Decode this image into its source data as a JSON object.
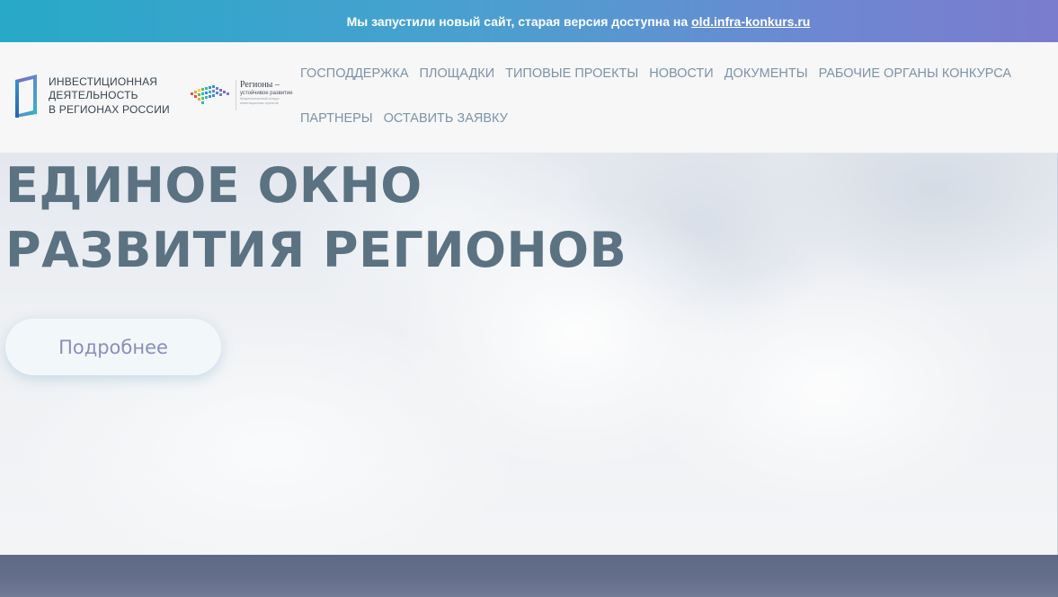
{
  "banner": {
    "message": "Мы запустили новый сайт, старая версия доступна на",
    "link_text": "old.infra-konkurs.ru"
  },
  "brand": {
    "line1": "Инвестиционная",
    "line2": "деятельность",
    "line3": "в регионах России"
  },
  "partner": {
    "title": "Регионы –",
    "subtitle": "устойчивое развитие",
    "caption": "Межрегиональный конкурс инвестиционных проектов"
  },
  "nav": {
    "items": [
      {
        "label": "Господдержка"
      },
      {
        "label": "Площадки"
      },
      {
        "label": "Типовые проекты"
      },
      {
        "label": "Новости"
      },
      {
        "label": "Документы"
      },
      {
        "label": "Рабочие органы конкурса"
      },
      {
        "label": "Партнеры"
      },
      {
        "label": "Оставить заявку"
      }
    ]
  },
  "hero": {
    "title": "Единое окно развития регионов",
    "button_label": "Подробнее"
  },
  "colors": {
    "banner_start": "#27a9c7",
    "banner_end": "#7b7cce",
    "nav_text": "#7d93a8",
    "hero_title": "#5b7283",
    "button_text": "#8a8fb8"
  }
}
